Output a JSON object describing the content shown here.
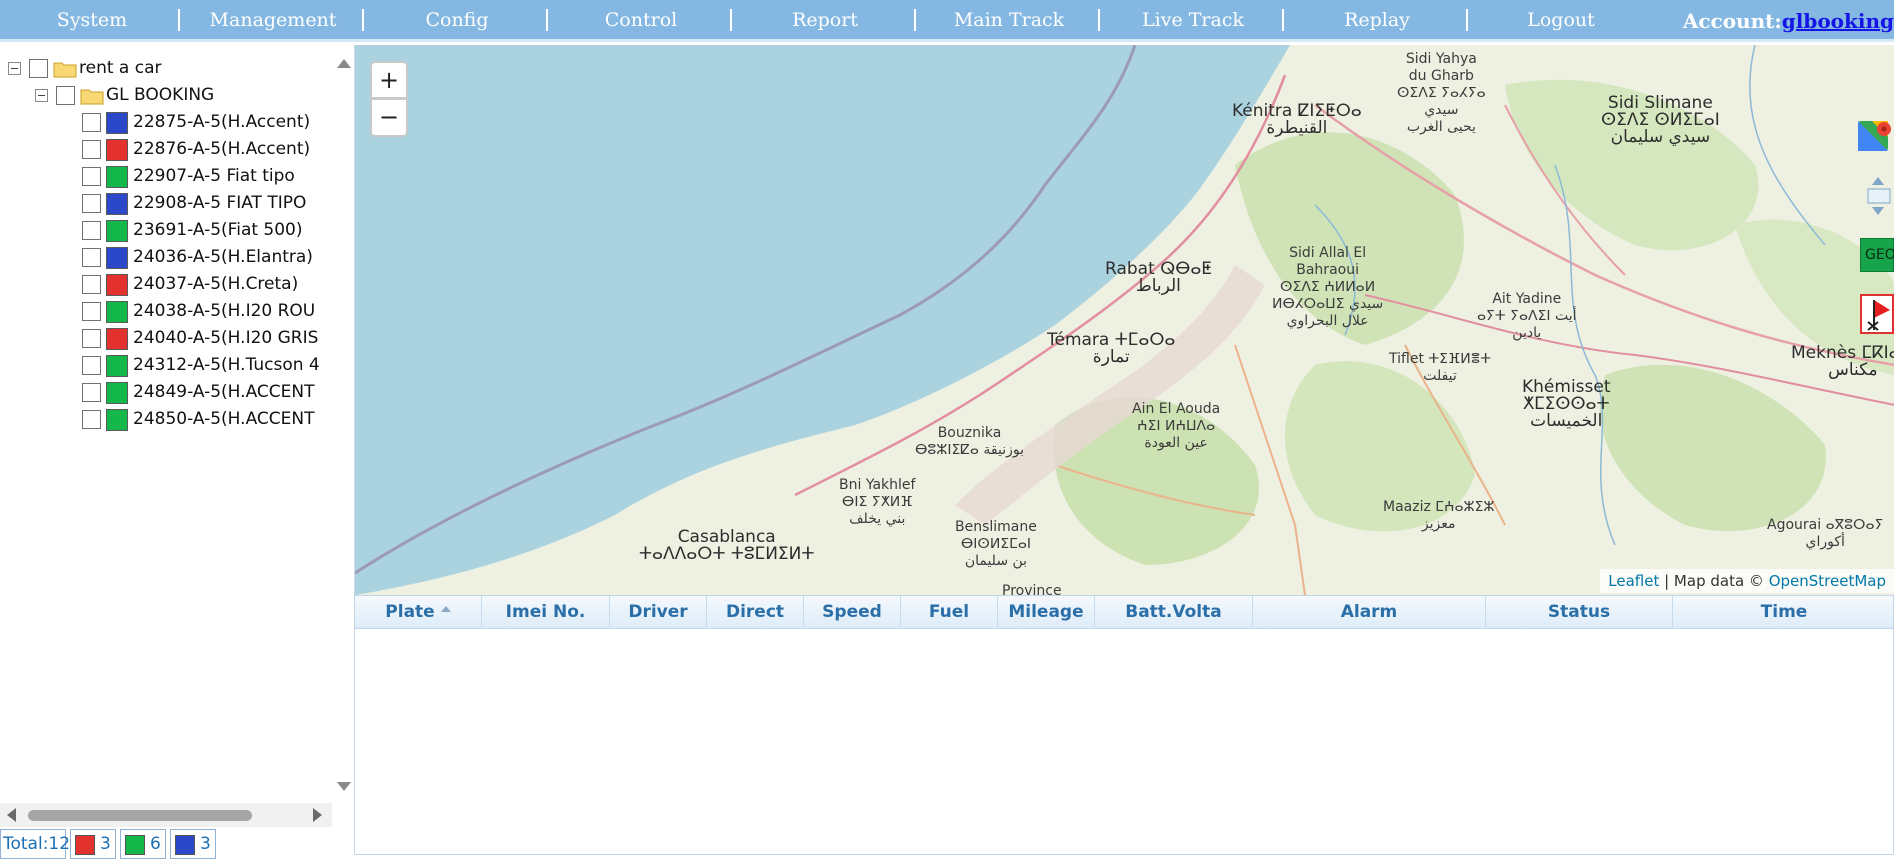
{
  "nav": {
    "items": [
      "System",
      "Management",
      "Config",
      "Control",
      "Report",
      "Main Track",
      "Live Track",
      "Replay",
      "Logout"
    ],
    "account_label": "Account:",
    "account_user": "glbooking"
  },
  "tree": {
    "root": "rent a car",
    "group": "GL BOOKING",
    "vehicles": [
      {
        "label": "22875-A-5(H.Accent)",
        "status": "blue"
      },
      {
        "label": "22876-A-5(H.Accent)",
        "status": "red"
      },
      {
        "label": "22907-A-5 Fiat tipo",
        "status": "green"
      },
      {
        "label": "22908-A-5 FIAT TIPO",
        "status": "blue"
      },
      {
        "label": "23691-A-5(Fiat 500)",
        "status": "green"
      },
      {
        "label": "24036-A-5(H.Elantra)",
        "status": "blue"
      },
      {
        "label": "24037-A-5(H.Creta)",
        "status": "red"
      },
      {
        "label": "24038-A-5(H.I20 ROU",
        "status": "green"
      },
      {
        "label": "24040-A-5(H.I20 GRIS",
        "status": "red"
      },
      {
        "label": "24312-A-5(H.Tucson 4",
        "status": "green"
      },
      {
        "label": "24849-A-5(H.ACCENT",
        "status": "green"
      },
      {
        "label": "24850-A-5(H.ACCENT",
        "status": "green"
      }
    ]
  },
  "footer": {
    "total": "Total:12",
    "red_count": "3",
    "green_count": "6",
    "blue_count": "3"
  },
  "colors": {
    "nav_bg": "#84b8e2",
    "status_red": "#e2312f",
    "status_green": "#13b74a",
    "status_blue": "#2a48c8",
    "table_header_text": "#2b6fa8"
  },
  "map": {
    "zoom_in": "+",
    "zoom_out": "−",
    "labels": [
      {
        "text": "Sidi Yahya\ndu Gharb\nⵙⵉⴷⵉ ⵢⴰⵃⵢⴰ\nسيدي\nيحيى الغرب"
      },
      {
        "text": "Kénitra ⵇⵏⵉⵟⵔⴰ\nالقنيطرة",
        "city": true
      },
      {
        "text": "Sidi Slimane\nⵙⵉⴷⵉ ⵙⵍⵉⵎⴰⵏ\nسيدي سليمان",
        "city": true
      },
      {
        "text": "Rabat ⵕⴱⴰⵟ\nالرباط",
        "city": true
      },
      {
        "text": "Témara ⵜⵎⴰⵔⴰ\nتمارة",
        "city": true
      },
      {
        "text": "Sidi Allal El\nBahraoui\nⵙⵉⴷⵉ ⵄⵍⵍⴰⵍ\nⵍⴱⵃⵔⴰⵡⵉ سيدي\nعلال البحراوي"
      },
      {
        "text": "Ait Yadine\nⴰⵢⵜ ⵢⴰⴷⵉⵏ أيت\nيادين"
      },
      {
        "text": "Tiflet ⵜⵉⴼⵍⴻⵜ\nتيفلت"
      },
      {
        "text": "Khémisset\nⵅⵎⵉⵙⵙⴰⵜ\nالخميسات",
        "city": true
      },
      {
        "text": "Meknès ⵎⴽⵏⴰⵙ\nمكناس",
        "city": true
      },
      {
        "text": "Ain El Aouda\nⵄⵉⵏ ⵍⵄⵡⴷⴰ\nعين العودة"
      },
      {
        "text": "Bouznika\nⴱⵓⵣⵏⵉⵇⴰ بوزنيقة"
      },
      {
        "text": "Bni Yakhlef\nⴱⵏⵉ ⵢⵅⵍⴼ\nبني يخلف"
      },
      {
        "text": "Benslimane\nⴱⵏⵙⵍⵉⵎⴰⵏ\nبن سليمان"
      },
      {
        "text": "Casablanca\nⵜⴰⴷⴷⴰⵔⵜ ⵜⵓⵎⵍⵉⵍⵜ",
        "city": true
      },
      {
        "text": "Maaziz ⵎⵄⴰⵣⵉⵣ\nمعزيز"
      },
      {
        "text": "Agourai ⴰⴳⵓⵔⴰⵢ\nأكوراي"
      },
      {
        "text": "Province"
      }
    ],
    "attribution_leaflet": "Leaflet",
    "attribution_text": " | Map data © ",
    "attribution_osm": "OpenStreetMap",
    "tools": [
      "google-maps-icon",
      "pan-icon",
      "geofence-icon",
      "flag-icon"
    ],
    "geo_label": "GEO"
  },
  "table": {
    "columns": [
      "Plate",
      "Imei No.",
      "Driver",
      "Direct",
      "Speed",
      "Fuel",
      "Mileage",
      "Batt.Volta",
      "Alarm",
      "Status",
      "Time"
    ],
    "rows": []
  }
}
